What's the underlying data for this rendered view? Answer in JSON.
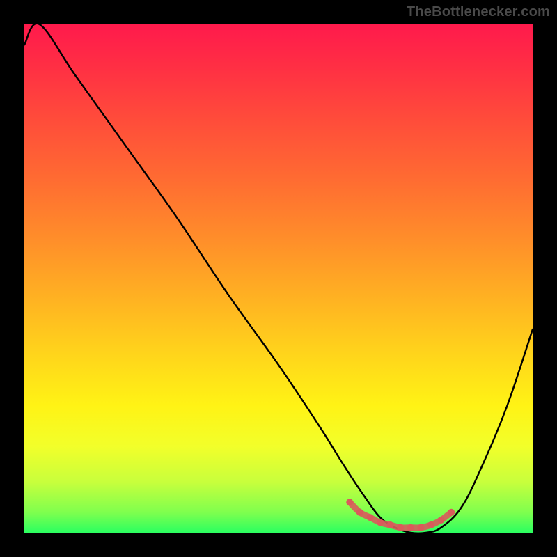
{
  "watermark": "TheBottlenecker.com",
  "colors": {
    "page_bg": "#000000",
    "curve": "#000000",
    "marker": "#d95b5b",
    "watermark": "#4a4a4a"
  },
  "chart_data": {
    "type": "line",
    "title": "",
    "xlabel": "",
    "ylabel": "",
    "xlim": [
      0,
      100
    ],
    "ylim": [
      0,
      100
    ],
    "grid": false,
    "legend": false,
    "series": [
      {
        "name": "bottleneck-curve",
        "x": [
          0,
          3,
          10,
          20,
          30,
          40,
          50,
          58,
          63,
          67,
          70,
          73,
          76,
          79,
          82,
          86,
          90,
          95,
          100
        ],
        "y": [
          96,
          100,
          90,
          76,
          62,
          47,
          33,
          21,
          13,
          7,
          3,
          1,
          0,
          0,
          1,
          5,
          13,
          25,
          40
        ]
      }
    ],
    "markers": {
      "name": "optimal-zone",
      "x": [
        64,
        66,
        68,
        70,
        72,
        74,
        76,
        78,
        80,
        82,
        84
      ],
      "y": [
        6,
        4,
        3,
        2,
        1.5,
        1,
        1,
        1,
        1.5,
        2.5,
        4
      ]
    }
  }
}
